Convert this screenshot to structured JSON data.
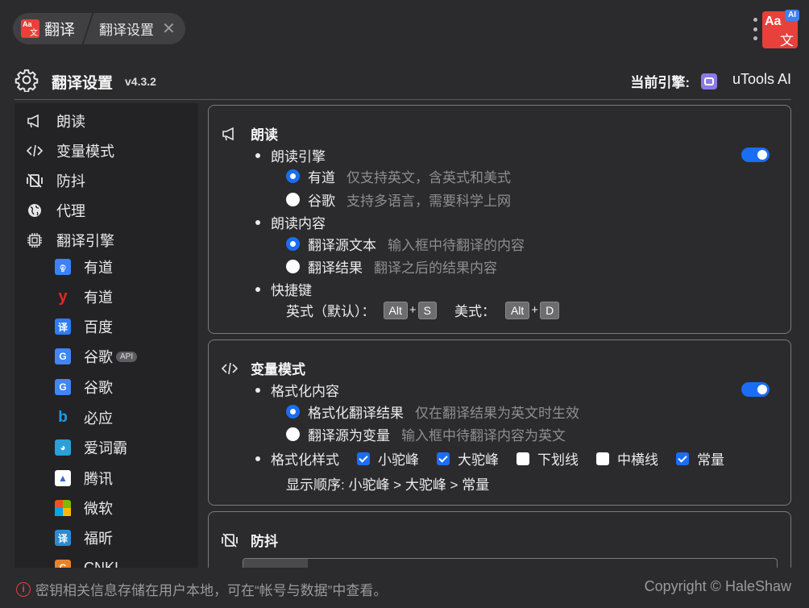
{
  "topbar": {
    "logo_text_a": "Aa",
    "logo_text_b": "文",
    "tab_title": "翻译",
    "tab_sub": "翻译设置",
    "close_glyph": "✕",
    "app_logo_ai": "AI",
    "app_logo_aa": "Aa",
    "app_logo_wen": "文"
  },
  "header": {
    "title": "翻译设置",
    "version": "v4.3.2",
    "engine_label": "当前引擎:",
    "engine_name": "uTools AI",
    "engine_icon": "robot-icon"
  },
  "sidebar": {
    "items": [
      {
        "label": "朗读",
        "icon": "megaphone-icon"
      },
      {
        "label": "变量模式",
        "icon": "code-icon"
      },
      {
        "label": "防抖",
        "icon": "vibration-off-icon"
      },
      {
        "label": "代理",
        "icon": "globe-icon"
      },
      {
        "label": "翻译引擎",
        "icon": "chip-icon"
      }
    ],
    "engines": [
      {
        "label": "有道",
        "icon": "youdao-ai-icon",
        "color": "#3b82f6"
      },
      {
        "label": "有道",
        "icon": "youdao-icon",
        "color": "#e02a2a"
      },
      {
        "label": "百度",
        "icon": "baidu-icon",
        "color": "#2e7cf6"
      },
      {
        "label": "谷歌",
        "icon": "google-translate-icon",
        "color": "#4285f4",
        "badge": "API"
      },
      {
        "label": "谷歌",
        "icon": "google-translate-icon",
        "color": "#4285f4"
      },
      {
        "label": "必应",
        "icon": "bing-icon",
        "color": "#1a73c8"
      },
      {
        "label": "爱词霸",
        "icon": "iciba-icon",
        "color": "#2aa0d8"
      },
      {
        "label": "腾讯",
        "icon": "tencent-icon",
        "color": "#2d6ad6"
      },
      {
        "label": "微软",
        "icon": "microsoft-icon",
        "color": "#f25022"
      },
      {
        "label": "福昕",
        "icon": "foxit-icon",
        "color": "#2b8cd8"
      },
      {
        "label": "CNKI",
        "icon": "cnki-icon",
        "color": "#e8832a"
      }
    ]
  },
  "read_panel": {
    "title": "朗读",
    "engine_label": "朗读引擎",
    "engine_enabled": true,
    "engine_options": [
      {
        "label": "有道",
        "hint": "仅支持英文，含英式和美式",
        "selected": true
      },
      {
        "label": "谷歌",
        "hint": "支持多语言，需要科学上网",
        "selected": false
      }
    ],
    "content_label": "朗读内容",
    "content_options": [
      {
        "label": "翻译源文本",
        "hint": "输入框中待翻译的内容",
        "selected": true
      },
      {
        "label": "翻译结果",
        "hint": "翻译之后的结果内容",
        "selected": false
      }
    ],
    "hotkey_label": "快捷键",
    "hotkey_en_label": "英式（默认）：",
    "hotkey_us_label": "美式：",
    "key_alt": "Alt",
    "key_s": "S",
    "key_d": "D",
    "plus": "+"
  },
  "var_panel": {
    "title": "变量模式",
    "format_label": "格式化内容",
    "format_enabled": true,
    "format_options": [
      {
        "label": "格式化翻译结果",
        "hint": "仅在翻译结果为英文时生效",
        "selected": true
      },
      {
        "label": "翻译源为变量",
        "hint": "输入框中待翻译内容为英文",
        "selected": false
      }
    ],
    "style_label": "格式化样式",
    "styles": [
      {
        "label": "小驼峰",
        "checked": true
      },
      {
        "label": "大驼峰",
        "checked": true
      },
      {
        "label": "下划线",
        "checked": false
      },
      {
        "label": "中横线",
        "checked": false
      },
      {
        "label": "常量",
        "checked": true
      }
    ],
    "order_text": "显示顺序:  小驼峰 > 大驼峰 > 常量"
  },
  "debounce_panel": {
    "title": "防抖"
  },
  "footer": {
    "info_icon": "i",
    "info_text": "密钥相关信息存储在用户本地，可在“帐号与数据”中查看。",
    "copyright": "Copyright © HaleShaw"
  }
}
